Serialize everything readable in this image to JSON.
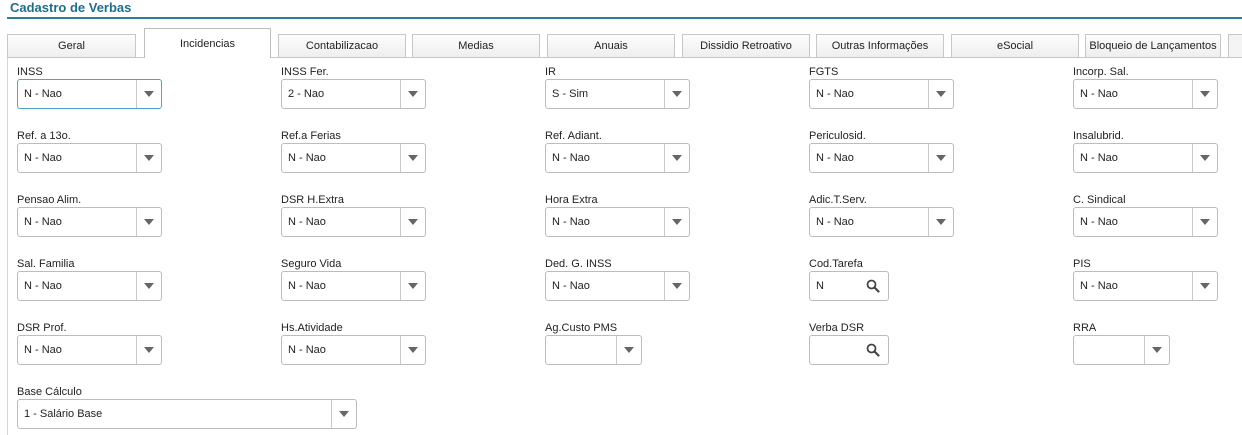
{
  "page_title": "Cadastro de Verbas",
  "tabs": [
    {
      "label": "Geral"
    },
    {
      "label": "Incidencias"
    },
    {
      "label": "Contabilizacao"
    },
    {
      "label": "Medias"
    },
    {
      "label": "Anuais"
    },
    {
      "label": "Dissidio Retroativo"
    },
    {
      "label": "Outras Informações"
    },
    {
      "label": "eSocial"
    },
    {
      "label": "Bloqueio de Lançamentos"
    }
  ],
  "active_tab": "Incidencias",
  "fields": [
    {
      "label": "INSS",
      "value": "N - Nao",
      "kind": "select"
    },
    {
      "label": "INSS Fer.",
      "value": "2 - Nao",
      "kind": "select"
    },
    {
      "label": "IR",
      "value": "S - Sim",
      "kind": "select"
    },
    {
      "label": "FGTS",
      "value": "N - Nao",
      "kind": "select"
    },
    {
      "label": "Incorp. Sal.",
      "value": "N - Nao",
      "kind": "select"
    },
    {
      "label": "Ref. a 13o.",
      "value": "N - Nao",
      "kind": "select"
    },
    {
      "label": "Ref.a Ferias",
      "value": "N - Nao",
      "kind": "select"
    },
    {
      "label": "Ref. Adiant.",
      "value": "N - Nao",
      "kind": "select"
    },
    {
      "label": "Periculosid.",
      "value": "N - Nao",
      "kind": "select"
    },
    {
      "label": "Insalubrid.",
      "value": "N - Nao",
      "kind": "select"
    },
    {
      "label": "Pensao Alim.",
      "value": "N - Nao",
      "kind": "select"
    },
    {
      "label": "DSR H.Extra",
      "value": "N - Nao",
      "kind": "select"
    },
    {
      "label": "Hora Extra",
      "value": "N - Nao",
      "kind": "select"
    },
    {
      "label": "Adic.T.Serv.",
      "value": "N - Nao",
      "kind": "select"
    },
    {
      "label": "C. Sindical",
      "value": "N - Nao",
      "kind": "select"
    },
    {
      "label": "Sal. Familia",
      "value": "N - Nao",
      "kind": "select"
    },
    {
      "label": "Seguro Vida",
      "value": "N - Nao",
      "kind": "select"
    },
    {
      "label": "Ded. G. INSS",
      "value": "N - Nao",
      "kind": "select"
    },
    {
      "label": "Cod.Tarefa",
      "value": "N",
      "kind": "search"
    },
    {
      "label": "PIS",
      "value": "N - Nao",
      "kind": "select"
    },
    {
      "label": "DSR Prof.",
      "value": "N - Nao",
      "kind": "select"
    },
    {
      "label": "Hs.Atividade",
      "value": "N - Nao",
      "kind": "select"
    },
    {
      "label": "Ag.Custo PMS",
      "value": "",
      "kind": "select"
    },
    {
      "label": "Verba DSR",
      "value": "",
      "kind": "search"
    },
    {
      "label": "RRA",
      "value": "",
      "kind": "select"
    },
    {
      "label": "Base Cálculo",
      "value": "1 - Salário Base",
      "kind": "select"
    }
  ],
  "icons": {
    "dropdown": "chevron-down-icon",
    "search": "search-icon"
  },
  "colors": {
    "title": "#1c6f8c",
    "rule": "#2a7f95",
    "focus_border": "#4aa8c6"
  }
}
